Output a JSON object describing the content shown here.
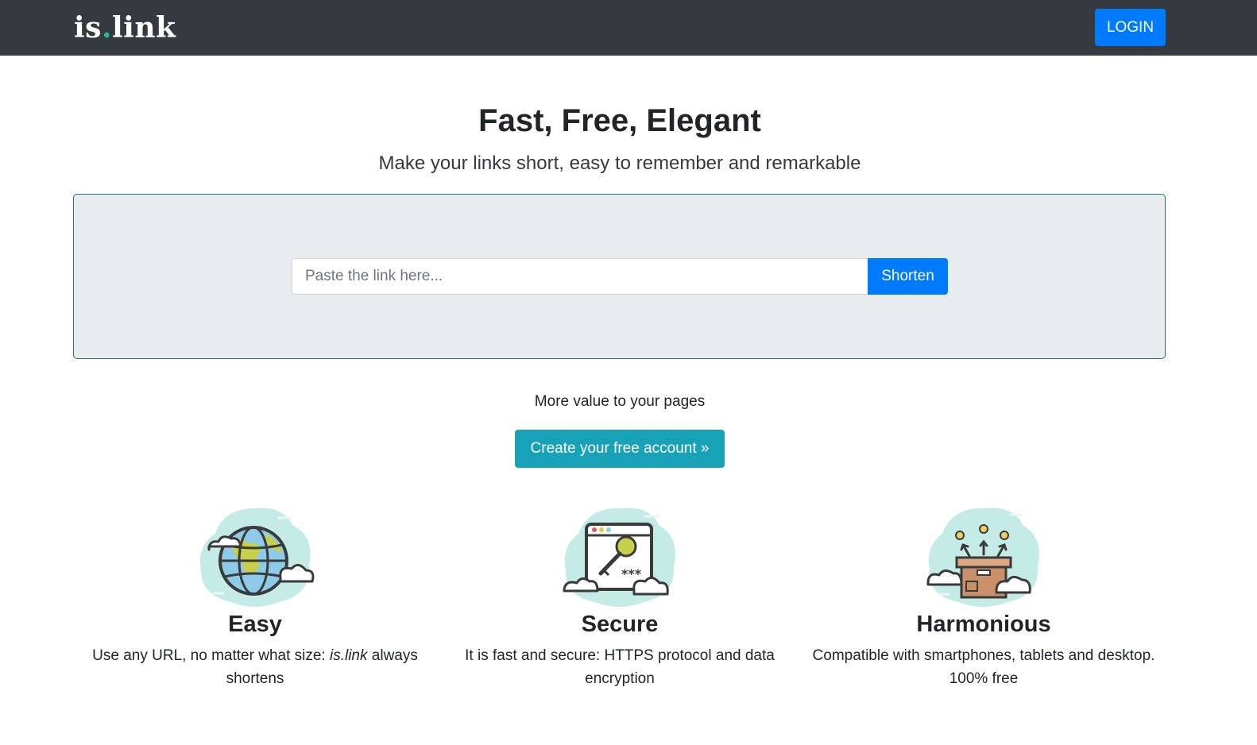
{
  "brand": {
    "logo_pre": "is",
    "logo_dot": ".",
    "logo_post": "link"
  },
  "nav": {
    "login_label": "LOGIN"
  },
  "hero": {
    "title": "Fast, Free, Elegant",
    "subtitle": "Make your links short, easy to remember and remarkable"
  },
  "shortener": {
    "placeholder": "Paste the link here...",
    "value": "",
    "button_label": "Shorten"
  },
  "cta": {
    "text": "More value to your pages",
    "button_label": "Create your free account »"
  },
  "features": [
    {
      "icon": "globe-icon",
      "title": "Easy",
      "desc_pre": "Use any URL, no matter what size: ",
      "desc_em": "is.link",
      "desc_post": " always shortens"
    },
    {
      "icon": "browser-key-icon",
      "title": "Secure",
      "desc": "It is fast and secure: HTTPS protocol and data encryption"
    },
    {
      "icon": "box-icon",
      "title": "Harmonious",
      "desc": "Compatible with smartphones, tablets and desktop. 100% free"
    }
  ],
  "colors": {
    "navbar": "#343a40",
    "primary": "#007bff",
    "info": "#17a2b8",
    "jumbotron": "#e9ecef",
    "logo_dot": "#1abc9c"
  }
}
